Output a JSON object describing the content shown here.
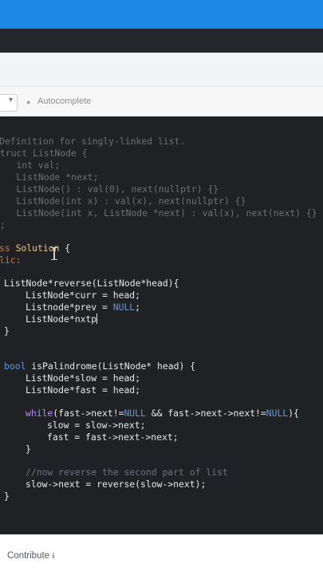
{
  "toolbar": {
    "autocomplete_label": "Autocomplete"
  },
  "editor": {
    "comment_lines": [
      "Definition for singly-linked list.",
      "struct ListNode {",
      "    int val;",
      "    ListNode *next;",
      "    ListNode() : val(0), next(nullptr) {}",
      "    ListNode(int x) : val(x), next(nullptr) {}",
      "    ListNode(int x, ListNode *next) : val(x), next(next) {}",
      "};"
    ],
    "class_keyword": "ss",
    "class_name": "Solution",
    "class_brace": " {",
    "access": "lic:",
    "reverse_sig": "ListNode*reverse(ListNode*head){",
    "curr_decl": "ListNode*curr = head;",
    "prev_decl_a": "Listnode*prev = ",
    "null": "NULL",
    "semi": ";",
    "nxtp_decl": "ListNode*nxtp",
    "close_brace": "}",
    "bool_kw": "bool",
    "palin_sig": " isPalindrome(ListNode* head) {",
    "slow_decl": "ListNode*slow = head;",
    "fast_decl": "ListNode*fast = head;",
    "while_kw": "while",
    "while_cond_a": "(fast->next!=",
    "while_cond_b": " && fast->next->next!=",
    "while_cond_c": "){",
    "slow_step": "slow = slow->next;",
    "fast_step": "fast = fast->next->next;",
    "inner_close": "}",
    "comment_reverse": "//now reverse the second part of list",
    "slow_next": "slow->next = reverse(slow->next);",
    "outer_close": "}"
  },
  "footer": {
    "contribute_label": "Contribute"
  },
  "footer_icon": "external-link-icon",
  "colors": {
    "top_bar": "#1e88e5",
    "editor_bg": "#1f2124",
    "keyword": "#cc7832",
    "class_name": "#f0c674",
    "constant": "#6897d6"
  }
}
